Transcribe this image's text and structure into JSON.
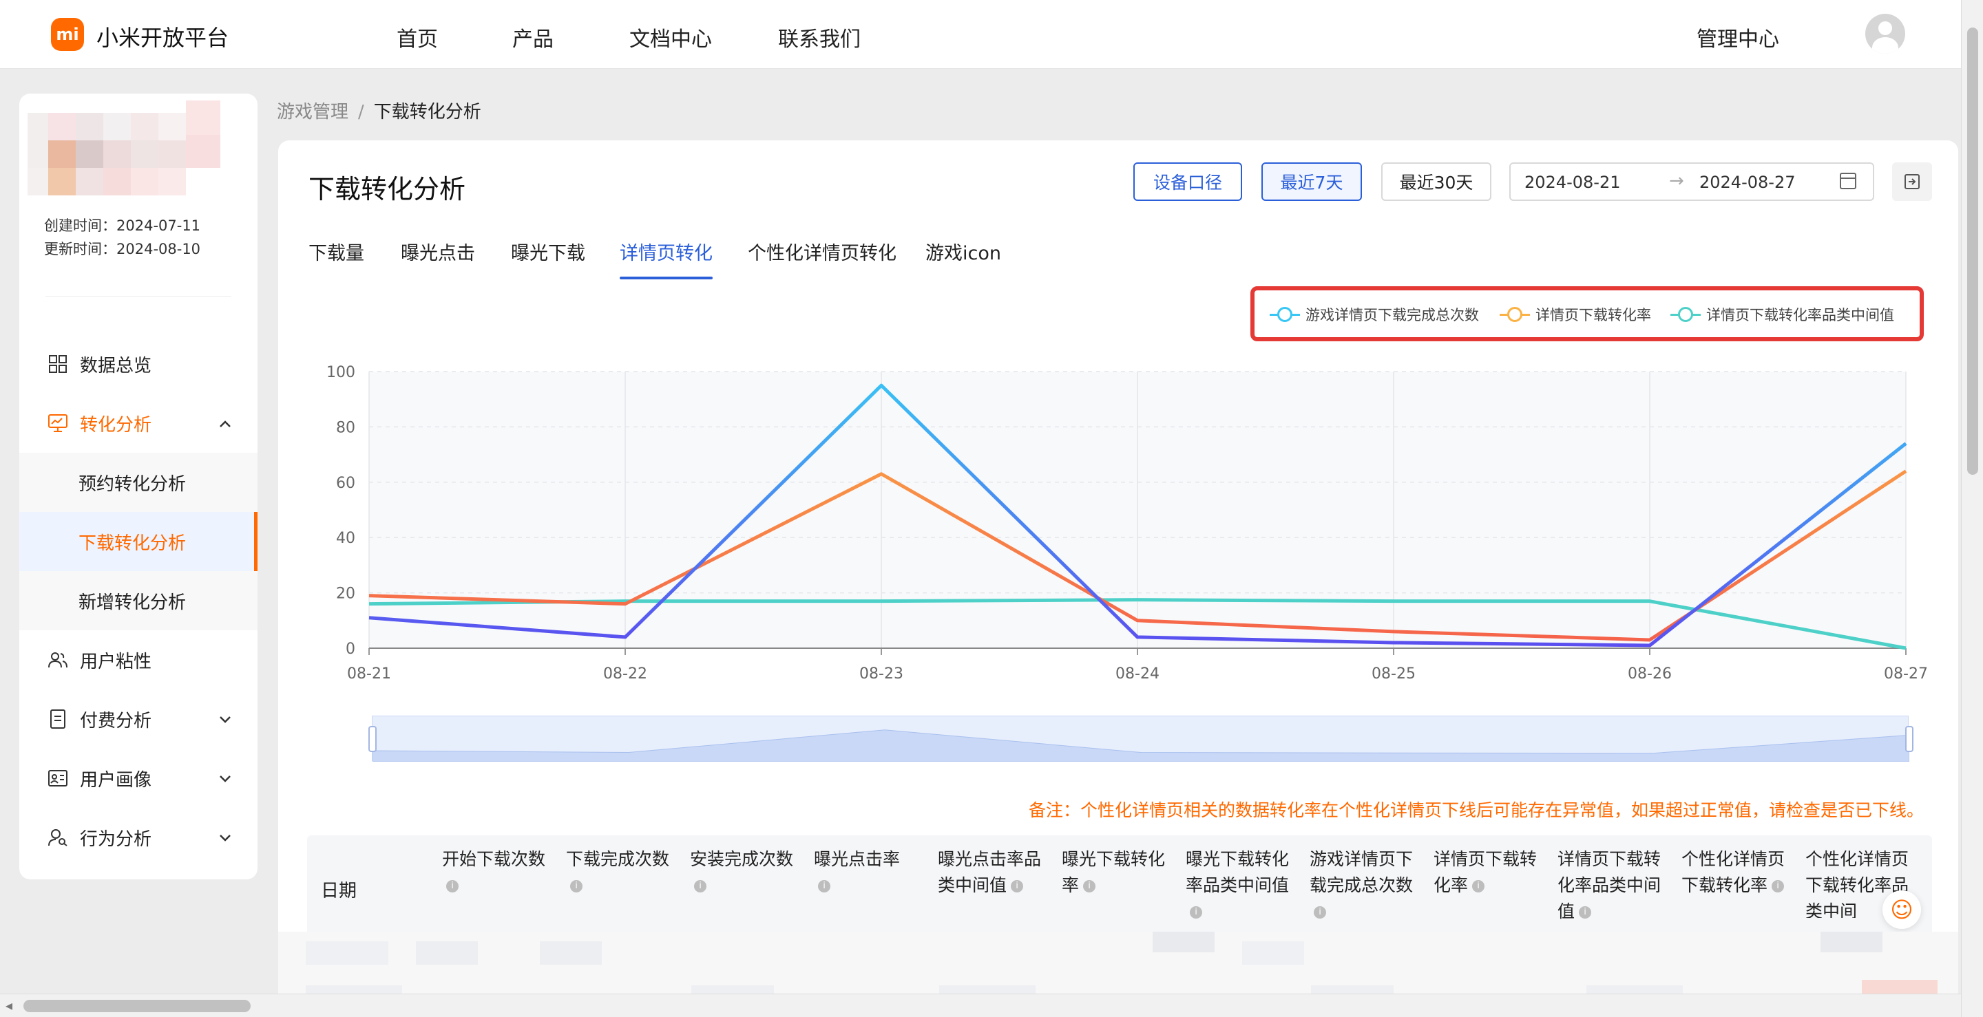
{
  "brand": {
    "logo_text": "mi",
    "name": "小米开放平台"
  },
  "nav": {
    "items": [
      "首页",
      "产品",
      "文档中心",
      "联系我们"
    ],
    "management": "管理中心"
  },
  "sidebar": {
    "created": "创建时间：2024-07-11",
    "updated": "更新时间：2024-08-10",
    "menu": {
      "overview": "数据总览",
      "conversion": "转化分析",
      "conversion_subs": [
        "预约转化分析",
        "下载转化分析",
        "新增转化分析"
      ],
      "stickiness": "用户粘性",
      "payment": "付费分析",
      "portrait": "用户画像",
      "behavior": "行为分析"
    }
  },
  "breadcrumb": {
    "parent": "游戏管理",
    "separator": "/",
    "current": "下载转化分析"
  },
  "page": {
    "title": "下载转化分析",
    "buttons": {
      "device": "设备口径",
      "last7": "最近7天",
      "last30": "最近30天"
    },
    "date_range": {
      "start": "2024-08-21",
      "arrow": "→",
      "end": "2024-08-27"
    },
    "tabs": [
      "下载量",
      "曝光点击",
      "曝光下载",
      "详情页转化",
      "个性化详情页转化",
      "游戏icon"
    ],
    "active_tab_index": 3
  },
  "chart_data": {
    "type": "line",
    "categories": [
      "08-21",
      "08-22",
      "08-23",
      "08-24",
      "08-25",
      "08-26",
      "08-27"
    ],
    "ylim": [
      0,
      100
    ],
    "yticks": [
      "0",
      "20",
      "40",
      "60",
      "80",
      "100"
    ],
    "grid": true,
    "legend_position": "top-right",
    "series": [
      {
        "name": "游戏详情页下载完成总次数",
        "color": "#38c6f4",
        "gradient_to": "#5b4ef0",
        "values": [
          11,
          4,
          95,
          4,
          2,
          1,
          74
        ]
      },
      {
        "name": "详情页下载转化率",
        "color": "#fbb244",
        "gradient_to": "#f5614a",
        "values": [
          19,
          16,
          63,
          10,
          6,
          3,
          64
        ]
      },
      {
        "name": "详情页下载转化率品类中间值",
        "color": "#4dd0c8",
        "values": [
          16,
          17,
          17,
          17.5,
          17,
          17,
          0
        ]
      }
    ]
  },
  "note": "备注：个性化详情页相关的数据转化率在个性化详情页下线后可能存在异常值，如果超过正常值，请检查是否已下线。",
  "table": {
    "headers": [
      "日期",
      "开始下载次数",
      "下载完成次数",
      "安装完成次数",
      "曝光点击率",
      "曝光点击率品类中间值",
      "曝光下载转化率",
      "曝光下载转化率品类中间值",
      "游戏详情页下载完成总次数",
      "详情页下载转化率",
      "详情页下载转化率品类中间值",
      "个性化详情页下载转化率",
      "个性化详情页下载转化率品类中间"
    ]
  }
}
